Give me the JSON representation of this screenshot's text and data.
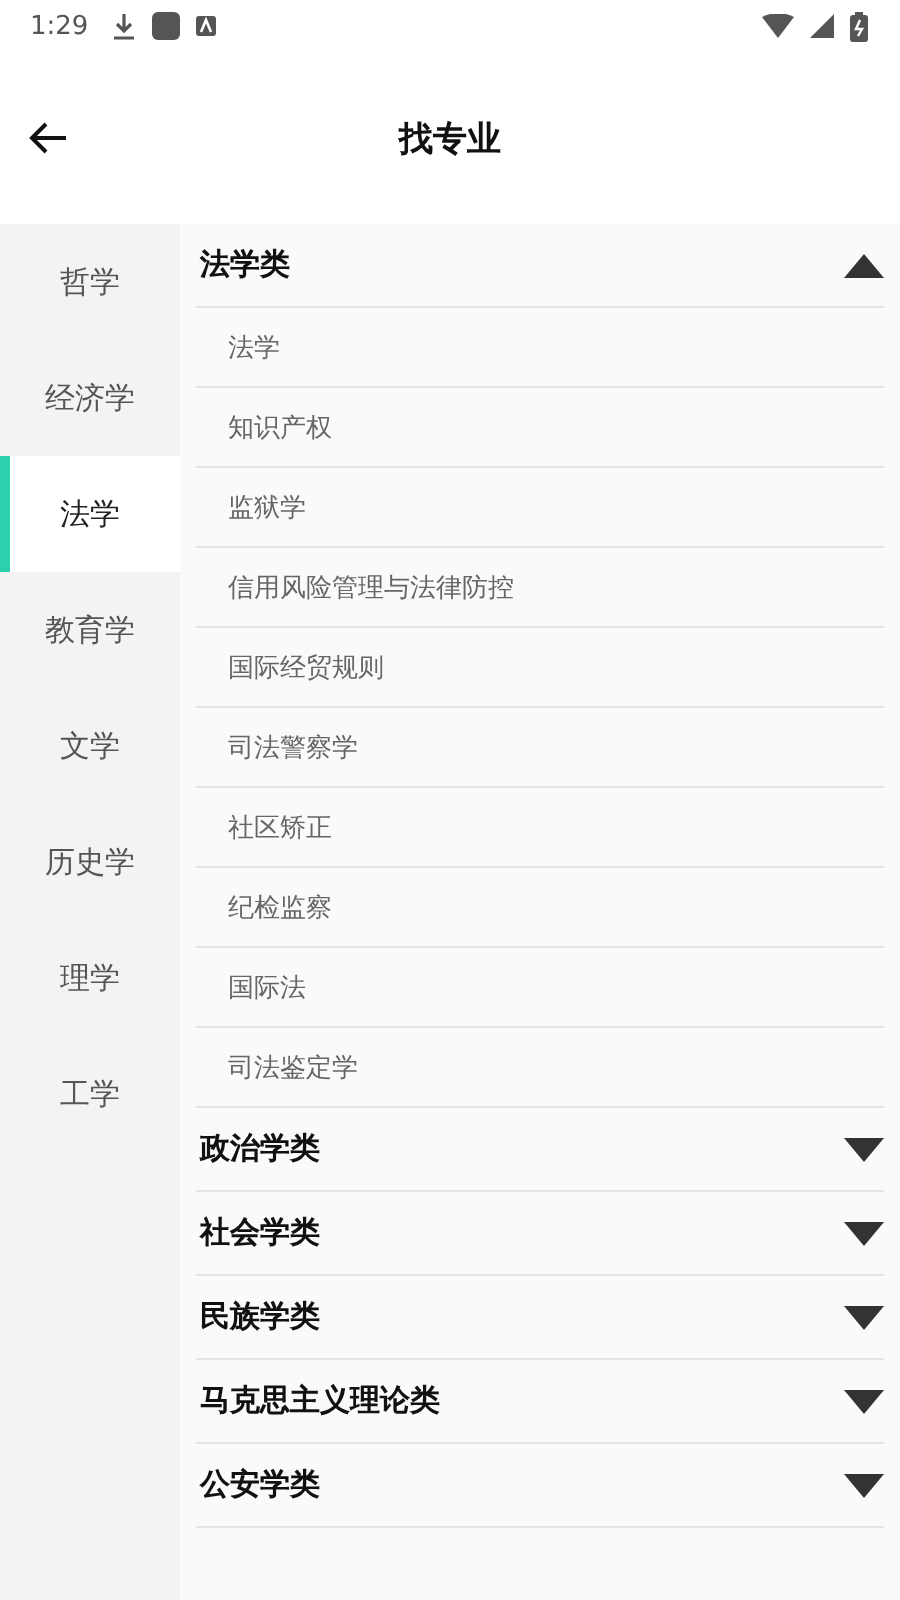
{
  "status_bar": {
    "time": "1:29"
  },
  "header": {
    "title": "找专业"
  },
  "sidebar": {
    "items": [
      {
        "label": "哲学",
        "selected": false
      },
      {
        "label": "经济学",
        "selected": false
      },
      {
        "label": "法学",
        "selected": true
      },
      {
        "label": "教育学",
        "selected": false
      },
      {
        "label": "文学",
        "selected": false
      },
      {
        "label": "历史学",
        "selected": false
      },
      {
        "label": "理学",
        "selected": false
      },
      {
        "label": "工学",
        "selected": false
      }
    ]
  },
  "groups": [
    {
      "title": "法学类",
      "expanded": true,
      "children": [
        "法学",
        "知识产权",
        "监狱学",
        "信用风险管理与法律防控",
        "国际经贸规则",
        "司法警察学",
        "社区矫正",
        "纪检监察",
        "国际法",
        "司法鉴定学"
      ]
    },
    {
      "title": "政治学类",
      "expanded": false
    },
    {
      "title": "社会学类",
      "expanded": false
    },
    {
      "title": "民族学类",
      "expanded": false
    },
    {
      "title": "马克思主义理论类",
      "expanded": false
    },
    {
      "title": "公安学类",
      "expanded": false
    }
  ]
}
